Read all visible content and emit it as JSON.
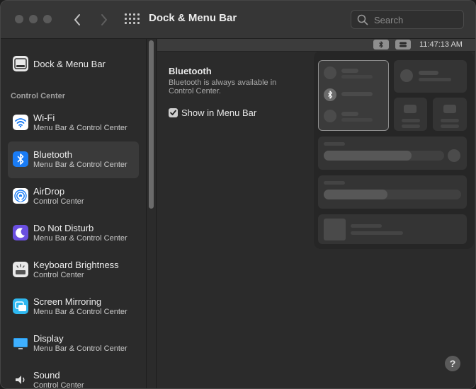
{
  "window": {
    "title": "Dock & Menu Bar"
  },
  "search": {
    "placeholder": "Search",
    "value": ""
  },
  "sidebar": {
    "top_item": {
      "label": "Dock & Menu Bar",
      "icon": "dock-icon"
    },
    "section_header": "Control Center",
    "items": [
      {
        "name": "Wi-Fi",
        "sub": "Menu Bar & Control Center",
        "icon": "wifi-icon",
        "color": "#ffffff"
      },
      {
        "name": "Bluetooth",
        "sub": "Menu Bar & Control Center",
        "icon": "bluetooth-icon",
        "color": "#1a7cf5",
        "selected": true
      },
      {
        "name": "AirDrop",
        "sub": "Control Center",
        "icon": "airdrop-icon",
        "color": "#ffffff"
      },
      {
        "name": "Do Not Disturb",
        "sub": "Menu Bar & Control Center",
        "icon": "moon-icon",
        "color": "#6a4fe0"
      },
      {
        "name": "Keyboard Brightness",
        "sub": "Control Center",
        "icon": "keyboard-brightness-icon",
        "color": "#e9e9e9"
      },
      {
        "name": "Screen Mirroring",
        "sub": "Menu Bar & Control Center",
        "icon": "screen-mirroring-icon",
        "color": "#2fb8f0"
      },
      {
        "name": "Display",
        "sub": "Menu Bar & Control Center",
        "icon": "display-icon",
        "color": "#2b9be8"
      },
      {
        "name": "Sound",
        "sub": "Control Center",
        "icon": "speaker-icon",
        "color": "#3a3a3a"
      }
    ]
  },
  "menubar_preview": {
    "time": "11:47:13 AM"
  },
  "setting": {
    "title": "Bluetooth",
    "description": "Bluetooth is always available in Control Center.",
    "checkbox_label": "Show in Menu Bar",
    "checked": true
  },
  "help": {
    "label": "?"
  },
  "colors": {
    "accent": "#1a7cf5",
    "window_bg": "#2b2b2b",
    "titlebar_bg": "#363636"
  }
}
